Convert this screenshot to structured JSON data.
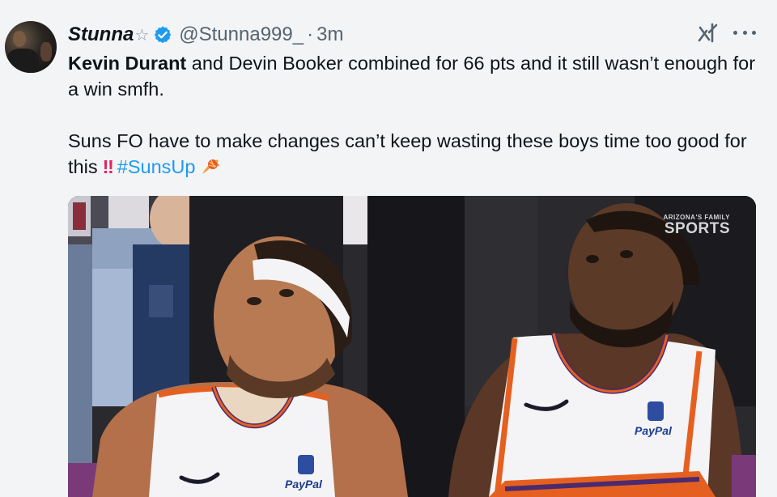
{
  "author": {
    "display_name": "Stunna",
    "name_symbol": "☆",
    "handle": "@Stunna999_",
    "separator": "·",
    "timestamp": "3m",
    "verified": true
  },
  "tweet": {
    "line1_bold": "Kevin Durant",
    "line1_rest": " and Devin Booker combined for 66 pts and it still wasn’t enough for a win smfh.",
    "line2_text": "Suns FO have to make changes can’t keep wasting these boys time too good for this",
    "line2_emoji": "‼",
    "hashtag": "#SunsUp",
    "trailing_emoji": "sun-emoji"
  },
  "media": {
    "watermark_small": "ARIZONA'S FAMILY",
    "watermark_big": "SPORTS",
    "sponsor_left": "PayPal",
    "sponsor_right": "PayPal"
  },
  "icons": [
    "verified-badge-icon",
    "grok-icon",
    "more-options-icon",
    "sun-emoji"
  ],
  "colors": {
    "link": "#1d9bf0",
    "verified": "#1d9bf0",
    "secondary_text": "#536471",
    "background": "#f3f4f6",
    "jersey_orange": "#e56020",
    "jersey_purple": "#4b2a6e"
  }
}
